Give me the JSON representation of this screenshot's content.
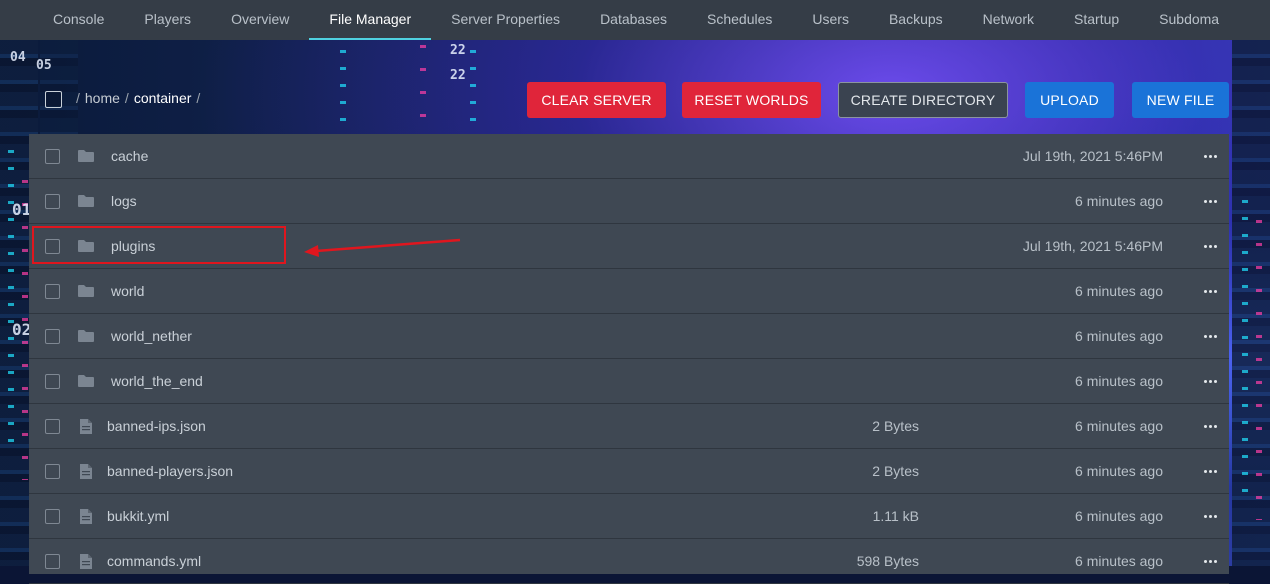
{
  "nav": {
    "tabs": [
      {
        "label": "Console"
      },
      {
        "label": "Players"
      },
      {
        "label": "Overview"
      },
      {
        "label": "File Manager",
        "active": true
      },
      {
        "label": "Server Properties"
      },
      {
        "label": "Databases"
      },
      {
        "label": "Schedules"
      },
      {
        "label": "Users"
      },
      {
        "label": "Backups"
      },
      {
        "label": "Network"
      },
      {
        "label": "Startup"
      },
      {
        "label": "Subdoma"
      }
    ]
  },
  "breadcrumb": {
    "sep": "/",
    "home": "home",
    "current": "container"
  },
  "toolbar": {
    "clear_server": "CLEAR SERVER",
    "reset_worlds": "RESET WORLDS",
    "create_directory": "CREATE DIRECTORY",
    "upload": "UPLOAD",
    "new_file": "NEW FILE"
  },
  "files": [
    {
      "name": "cache",
      "type": "folder",
      "size": "",
      "modified": "Jul 19th, 2021 5:46PM"
    },
    {
      "name": "logs",
      "type": "folder",
      "size": "",
      "modified": "6 minutes ago"
    },
    {
      "name": "plugins",
      "type": "folder",
      "size": "",
      "modified": "Jul 19th, 2021 5:46PM"
    },
    {
      "name": "world",
      "type": "folder",
      "size": "",
      "modified": "6 minutes ago"
    },
    {
      "name": "world_nether",
      "type": "folder",
      "size": "",
      "modified": "6 minutes ago"
    },
    {
      "name": "world_the_end",
      "type": "folder",
      "size": "",
      "modified": "6 minutes ago"
    },
    {
      "name": "banned-ips.json",
      "type": "file",
      "size": "2 Bytes",
      "modified": "6 minutes ago"
    },
    {
      "name": "banned-players.json",
      "type": "file",
      "size": "2 Bytes",
      "modified": "6 minutes ago"
    },
    {
      "name": "bukkit.yml",
      "type": "file",
      "size": "1.11 kB",
      "modified": "6 minutes ago"
    },
    {
      "name": "commands.yml",
      "type": "file",
      "size": "598 Bytes",
      "modified": "6 minutes ago"
    }
  ],
  "colors": {
    "nav_bg": "#353d47",
    "active_underline": "#4fd1e0",
    "danger": "#e0253a",
    "primary": "#1a73d8",
    "row_bg": "#3f4853",
    "annotation": "#e0161e"
  }
}
